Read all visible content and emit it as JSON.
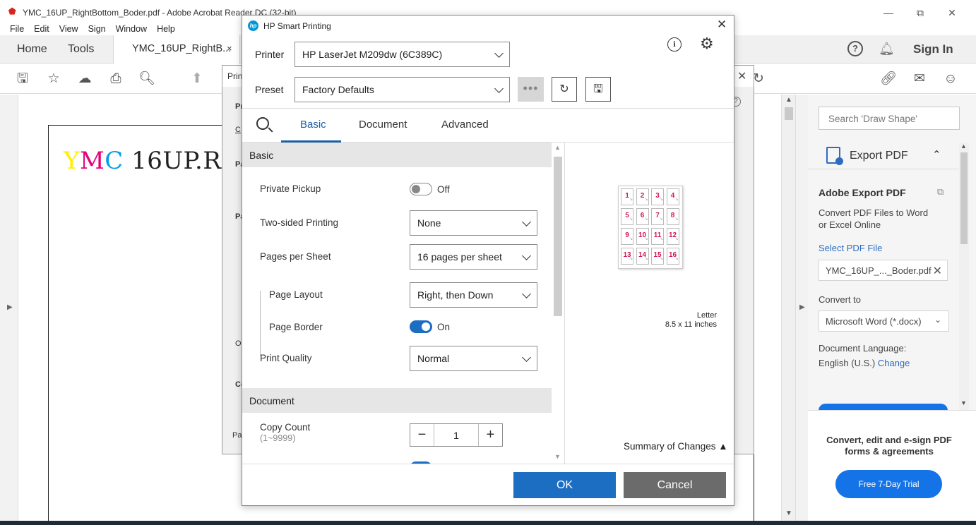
{
  "window": {
    "title": "YMC_16UP_RightBottom_Boder.pdf - Adobe Acrobat Reader DC (32-bit)",
    "controls": [
      "minimize-icon",
      "restore-icon",
      "close-icon"
    ]
  },
  "menu": [
    "File",
    "Edit",
    "View",
    "Sign",
    "Window",
    "Help"
  ],
  "tabs": {
    "home": "Home",
    "tools": "Tools",
    "doc": "YMC_16UP_RightB...",
    "doc_close": "×"
  },
  "header": {
    "help": "?",
    "signin": "Sign In"
  },
  "document": {
    "text_y": "Y",
    "text_m": "M",
    "text_c": "C",
    "text_rest": " 16UP.R"
  },
  "right_pane": {
    "search_placeholder": "Search 'Draw Shape'",
    "export_label": "Export PDF",
    "title": "Adobe Export PDF",
    "description": "Convert PDF Files to Word or Excel Online",
    "select_file": "Select PDF File",
    "file_name": "YMC_16UP_..._Boder.pdf",
    "convert_to": "Convert to",
    "format": "Microsoft Word (*.docx)",
    "doc_language_label": "Document Language:",
    "doc_language": "English (U.S.)",
    "change": "Change",
    "promo_text": "Convert, edit and e-sign PDF forms & agreements",
    "trial_button": "Free 7-Day Trial",
    "accent": "#1473e6"
  },
  "bg_dialog": {
    "title": "Prin",
    "labels": [
      "Pr",
      "C",
      "Pa",
      "Pa",
      "O",
      "Co",
      "Pa"
    ]
  },
  "hp_dialog": {
    "title": "HP Smart Printing",
    "printer_label": "Printer",
    "printer_value": "HP LaserJet M209dw (6C389C)",
    "preset_label": "Preset",
    "preset_value": "Factory Defaults",
    "more": "•••",
    "tabs": [
      "Basic",
      "Document",
      "Advanced"
    ],
    "active_tab": "Basic",
    "section_basic": "Basic",
    "private_pickup": {
      "label": "Private Pickup",
      "state": "Off"
    },
    "two_sided": {
      "label": "Two-sided Printing",
      "value": "None"
    },
    "pages_per_sheet": {
      "label": "Pages per Sheet",
      "value": "16 pages per sheet"
    },
    "page_layout": {
      "label": "Page Layout",
      "value": "Right, then Down"
    },
    "page_border": {
      "label": "Page Border",
      "state": "On"
    },
    "print_quality": {
      "label": "Print Quality",
      "value": "Normal"
    },
    "section_document": "Document",
    "copy_count": {
      "label": "Copy Count",
      "range": "(1~9999)",
      "value": "1",
      "minus": "−",
      "plus": "+"
    },
    "preview": {
      "pages": [
        "1",
        "2",
        "3",
        "4",
        "5",
        "6",
        "7",
        "8",
        "9",
        "10",
        "11",
        "12",
        "13",
        "14",
        "15",
        "16"
      ],
      "paper_name": "Letter",
      "paper_size": "8.5 x 11  inches"
    },
    "summary": "Summary of Changes ▲",
    "ok": "OK",
    "cancel": "Cancel",
    "accent": "#1b6ec2"
  }
}
